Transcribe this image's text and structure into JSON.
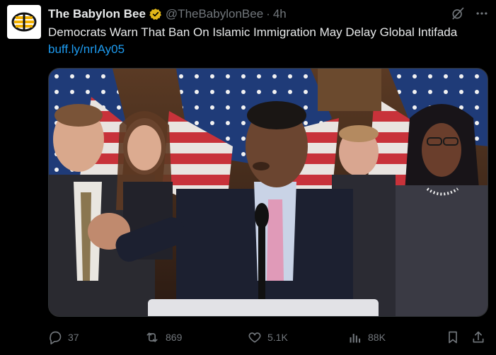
{
  "tweet": {
    "author_name": "The Babylon Bee",
    "handle": "@TheBabylonBee",
    "separator": "·",
    "time": "4h",
    "text": "Democrats Warn That Ban On Islamic Immigration May Delay Global Intifada",
    "link": "buff.ly/nrIAy05"
  },
  "actions": {
    "replies": "37",
    "reposts": "869",
    "likes": "5.1K",
    "views": "88K"
  },
  "colors": {
    "background": "#000000",
    "text": "#e7e9ea",
    "muted": "#71767b",
    "link": "#1d9bf0",
    "verified": "#e2b719"
  }
}
